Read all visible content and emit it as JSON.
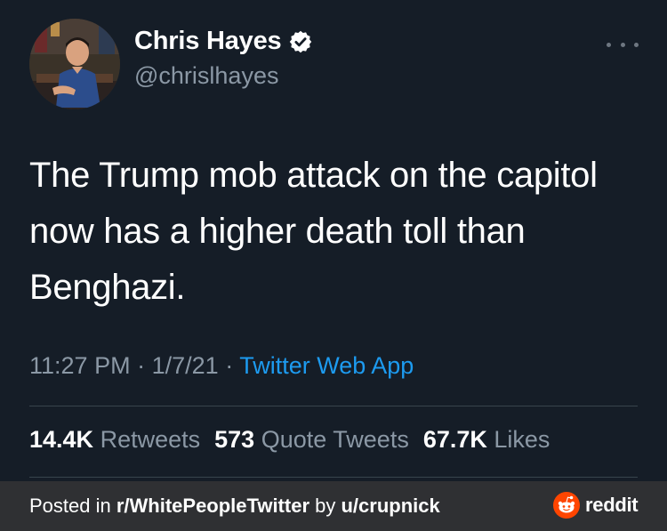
{
  "tweet": {
    "display_name": "Chris Hayes",
    "handle": "@chrislhayes",
    "verified": true,
    "text": "The Trump mob attack on the capitol now has a higher death toll than Benghazi.",
    "time": "11:27 PM",
    "date": "1/7/21",
    "separator": "·",
    "source": "Twitter Web App",
    "stats": {
      "retweets_count": "14.4K",
      "retweets_label": "Retweets",
      "quote_tweets_count": "573",
      "quote_tweets_label": "Quote Tweets",
      "likes_count": "67.7K",
      "likes_label": "Likes"
    }
  },
  "footer": {
    "posted_in_prefix": "Posted in ",
    "subreddit": "r/WhitePeopleTwitter",
    "by_text": " by ",
    "user": "u/crupnick",
    "brand": "reddit"
  },
  "colors": {
    "background": "#151d27",
    "footer_background": "#2f3033",
    "link_blue": "#1d9bf0",
    "muted_gray": "#8b98a5",
    "reddit_orange": "#ff4500"
  },
  "icons": {
    "verified": "verified-badge-icon",
    "more": "more-options-icon",
    "reddit": "reddit-alien-icon"
  }
}
